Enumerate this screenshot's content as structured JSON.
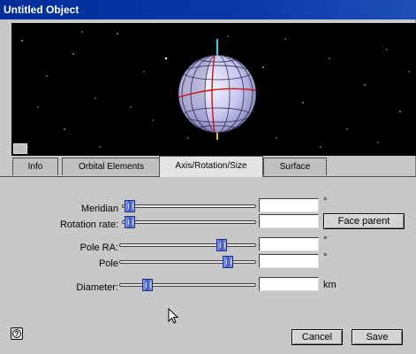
{
  "window": {
    "title": "Untitled Object"
  },
  "tabs": [
    {
      "label": "Info",
      "active": false
    },
    {
      "label": "Orbital Elements",
      "active": false
    },
    {
      "label": "Axis/Rotation/Size",
      "active": true
    },
    {
      "label": "Surface",
      "active": false
    }
  ],
  "fields": {
    "meridian": {
      "label": "Meridian",
      "value": "",
      "unit": "°",
      "slider_fraction": 0.02
    },
    "rotation_rate": {
      "label": "Rotation rate:",
      "value": "",
      "unit": "",
      "slider_fraction": 0.02
    },
    "pole_ra": {
      "label": "Pole RA:",
      "value": "",
      "unit": "°",
      "slider_fraction": 0.77
    },
    "pole": {
      "label": "Pole",
      "value": "",
      "unit": "°",
      "slider_fraction": 0.82
    },
    "diameter": {
      "label": "Diameter:",
      "value": "",
      "unit": "km",
      "slider_fraction": 0.18
    }
  },
  "buttons": {
    "face_parent": "Face parent",
    "cancel": "Cancel",
    "save": "Save",
    "help": "?"
  },
  "icons": {
    "help": "question-icon",
    "cursor": "arrow-cursor-icon"
  },
  "colors": {
    "titlebar": "#0a3aa8",
    "slider_thumb": "#3f58c8",
    "viewport_bg": "#000000"
  }
}
